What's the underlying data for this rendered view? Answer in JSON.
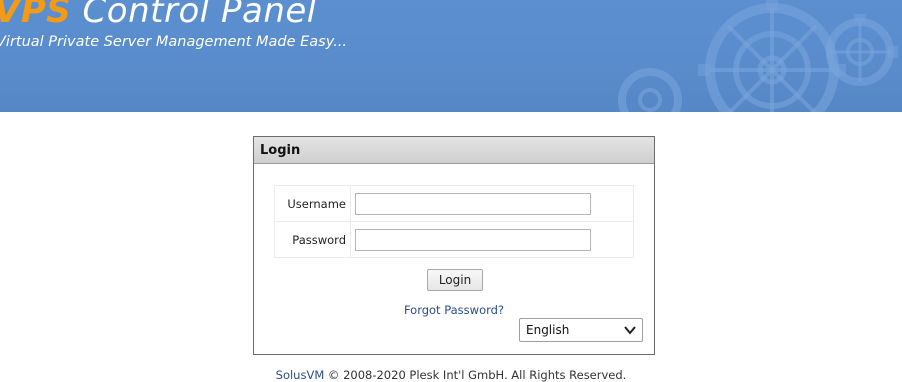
{
  "header": {
    "brand_accent": "VPS",
    "brand_rest": " Control Panel",
    "tagline": "Virtual Private Server Management Made Easy...",
    "colors": {
      "background": "#5a8ccc",
      "accent": "#f39a17",
      "text": "#ffffff"
    },
    "decoration_icon": "gears"
  },
  "login": {
    "panel_title": "Login",
    "username_label": "Username",
    "username_value": "",
    "password_label": "Password",
    "password_value": "",
    "submit_label": "Login",
    "forgot_label": "Forgot Password?",
    "language_selected": "English",
    "language_icon": "chevron-down-icon"
  },
  "footer": {
    "brand": "SolusVM",
    "text": " © 2008-2020 Plesk Int'l GmbH. All Rights Reserved."
  }
}
